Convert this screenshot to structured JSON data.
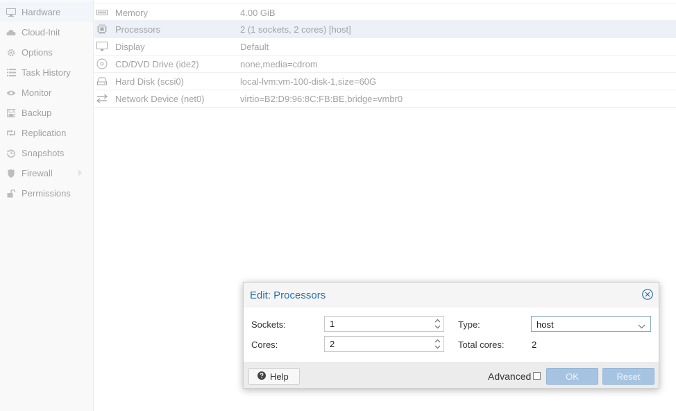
{
  "sidebar": {
    "items": [
      {
        "label": "Hardware",
        "icon": "monitor-icon",
        "active": true
      },
      {
        "label": "Cloud-Init",
        "icon": "cloud-icon"
      },
      {
        "label": "Options",
        "icon": "gear-icon"
      },
      {
        "label": "Task History",
        "icon": "list-icon"
      },
      {
        "label": "Monitor",
        "icon": "eye-icon"
      },
      {
        "label": "Backup",
        "icon": "floppy-icon"
      },
      {
        "label": "Replication",
        "icon": "retweet-icon"
      },
      {
        "label": "Snapshots",
        "icon": "history-icon"
      },
      {
        "label": "Firewall",
        "icon": "shield-icon",
        "has_submenu": true
      },
      {
        "label": "Permissions",
        "icon": "unlock-icon"
      }
    ]
  },
  "hardware": {
    "rows": [
      {
        "name": "Memory",
        "value": "4.00 GiB",
        "icon": "memory-icon"
      },
      {
        "name": "Processors",
        "value": "2 (1 sockets, 2 cores) [host]",
        "icon": "cpu-icon",
        "selected": true
      },
      {
        "name": "Display",
        "value": "Default",
        "icon": "desktop-icon"
      },
      {
        "name": "CD/DVD Drive (ide2)",
        "value": "none,media=cdrom",
        "icon": "cdrom-icon"
      },
      {
        "name": "Hard Disk (scsi0)",
        "value": "local-lvm:vm-100-disk-1,size=60G",
        "icon": "hdd-icon"
      },
      {
        "name": "Network Device (net0)",
        "value": "virtio=B2:D9:96:8C:FB:BE,bridge=vmbr0",
        "icon": "exchange-icon"
      }
    ]
  },
  "dialog": {
    "title": "Edit: Processors",
    "fields": {
      "sockets_label": "Sockets:",
      "sockets_value": "1",
      "cores_label": "Cores:",
      "cores_value": "2",
      "type_label": "Type:",
      "type_value": "host",
      "total_cores_label": "Total cores:",
      "total_cores_value": "2"
    },
    "footer": {
      "help_label": "Help",
      "advanced_label": "Advanced",
      "advanced_checked": false,
      "ok_label": "OK",
      "reset_label": "Reset"
    }
  },
  "colors": {
    "accent": "#2a6ea6",
    "primary_button_disabled": "#a6c4e2",
    "selected_row": "#dde7f3"
  }
}
